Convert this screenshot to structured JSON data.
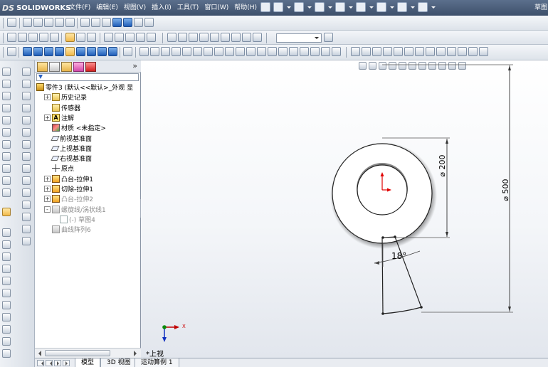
{
  "app": {
    "logo_text": "SOLIDWORKS",
    "corner_text": "草图"
  },
  "menu": [
    {
      "label": "文件(F)"
    },
    {
      "label": "编辑(E)"
    },
    {
      "label": "视图(V)"
    },
    {
      "label": "插入(I)"
    },
    {
      "label": "工具(T)"
    },
    {
      "label": "窗口(W)"
    },
    {
      "label": "帮助(H)"
    }
  ],
  "feature_tree": {
    "nodes": [
      {
        "label": "零件3 (默认<<默认>_外观 显",
        "icon": "part-icon",
        "expander": "",
        "indent": 0,
        "suppressed": false
      },
      {
        "label": "历史记录",
        "icon": "history-folder-icon",
        "expander": "+",
        "indent": 1,
        "suppressed": false
      },
      {
        "label": "传感器",
        "icon": "sensor-folder-icon",
        "expander": "",
        "indent": 1,
        "suppressed": false
      },
      {
        "label": "注解",
        "icon": "annotation-icon",
        "expander": "+",
        "indent": 1,
        "suppressed": false
      },
      {
        "label": "材质 <未指定>",
        "icon": "material-icon",
        "expander": "",
        "indent": 1,
        "suppressed": false
      },
      {
        "label": "前视基准面",
        "icon": "plane-icon",
        "expander": "",
        "indent": 1,
        "suppressed": false
      },
      {
        "label": "上视基准面",
        "icon": "plane-icon",
        "expander": "",
        "indent": 1,
        "suppressed": false
      },
      {
        "label": "右视基准面",
        "icon": "plane-icon",
        "expander": "",
        "indent": 1,
        "suppressed": false
      },
      {
        "label": "原点",
        "icon": "origin-icon",
        "expander": "",
        "indent": 1,
        "suppressed": false
      },
      {
        "label": "凸台-拉伸1",
        "icon": "boss-extrude-icon",
        "expander": "+",
        "indent": 1,
        "suppressed": false
      },
      {
        "label": "切除-拉伸1",
        "icon": "cut-extrude-icon",
        "expander": "+",
        "indent": 1,
        "suppressed": false
      },
      {
        "label": "凸台-拉伸2",
        "icon": "boss-extrude-icon",
        "expander": "+",
        "indent": 1,
        "suppressed": true
      },
      {
        "label": "螺旋线/涡状线1",
        "icon": "helix-icon",
        "expander": "-",
        "indent": 1,
        "suppressed": true
      },
      {
        "label": "(-) 草图4",
        "icon": "sketch-icon",
        "expander": "",
        "indent": 2,
        "suppressed": true
      },
      {
        "label": "曲线阵列6",
        "icon": "curve-pattern-icon",
        "expander": "",
        "indent": 1,
        "suppressed": true
      }
    ]
  },
  "viewport": {
    "view_label": "*上视",
    "triad_axis_label": "X",
    "dimensions": {
      "inner_diameter": "200",
      "outer_diameter": "500",
      "angle": "18°"
    }
  },
  "bottom_tabs": [
    {
      "label": "模型",
      "active": true
    },
    {
      "label": "3D 视图",
      "active": false
    },
    {
      "label": "运动算例 1",
      "active": false
    }
  ],
  "colors": {
    "titlebar": "#4a5d7a",
    "origin_red": "#e00000",
    "triad_green": "#0a8a0a",
    "triad_blue": "#1030c0"
  }
}
